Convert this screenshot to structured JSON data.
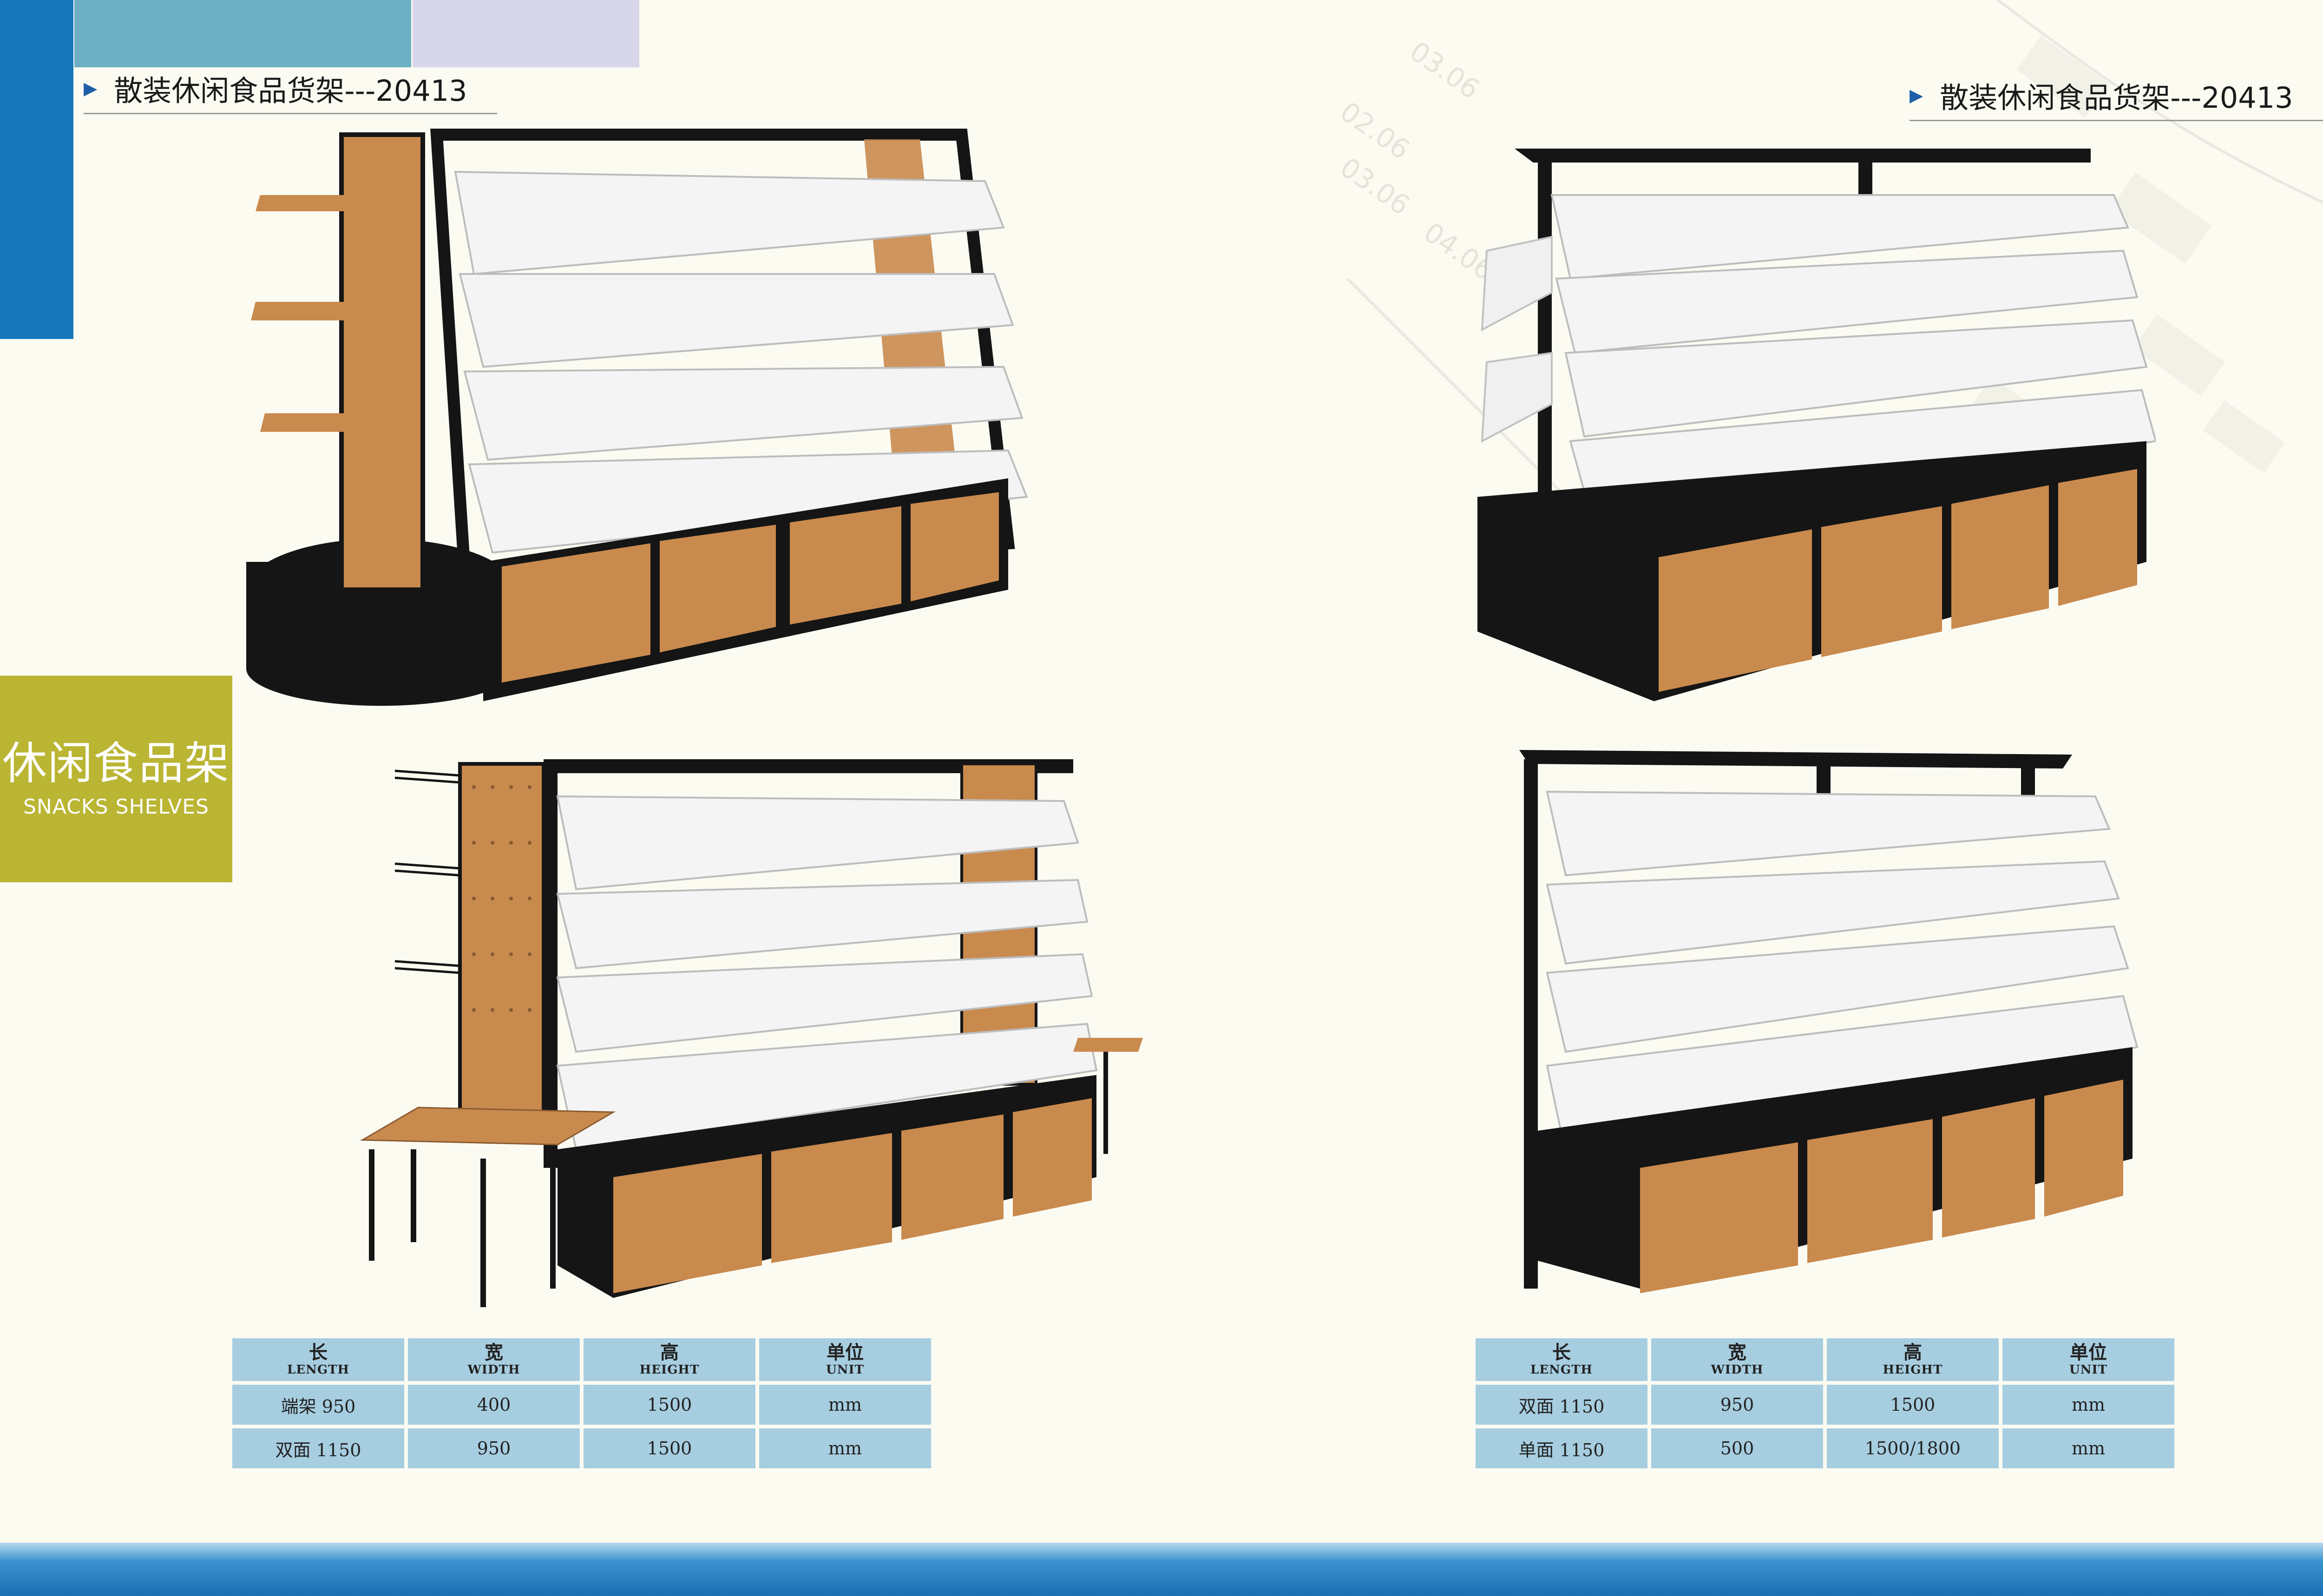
{
  "page": {
    "category": {
      "cn": "休闲食品架",
      "en": "SNACKS  SHELVES"
    },
    "left_title": "散装休闲食品货架---20413",
    "right_title": "散装休闲食品货架---20413",
    "watermark": [
      "03.06",
      "02.06",
      "03.06",
      "04.06"
    ]
  },
  "colors": {
    "blue_bar": "#1777b9",
    "teal": "#6cb0c4",
    "lavender": "#d8d6e9",
    "olive": "#bab533",
    "table_cell": "#a6cde0",
    "frame_black": "#151515",
    "wood": "#c98a4e",
    "bin_white": "#f4f4f4"
  },
  "tables": {
    "left": {
      "headers": [
        {
          "cn": "长",
          "en": "LENGTH"
        },
        {
          "cn": "宽",
          "en": "WIDTH"
        },
        {
          "cn": "高",
          "en": "HEIGHT"
        },
        {
          "cn": "单位",
          "en": "UNIT"
        }
      ],
      "rows": [
        [
          "端架 950",
          "400",
          "1500",
          "mm"
        ],
        [
          "双面 1150",
          "950",
          "1500",
          "mm"
        ]
      ]
    },
    "right": {
      "headers": [
        {
          "cn": "长",
          "en": "LENGTH"
        },
        {
          "cn": "宽",
          "en": "WIDTH"
        },
        {
          "cn": "高",
          "en": "HEIGHT"
        },
        {
          "cn": "单位",
          "en": "UNIT"
        }
      ],
      "rows": [
        [
          "双面 1150",
          "950",
          "1500",
          "mm"
        ],
        [
          "单面 1150",
          "500",
          "1500/1800",
          "mm"
        ]
      ]
    }
  }
}
